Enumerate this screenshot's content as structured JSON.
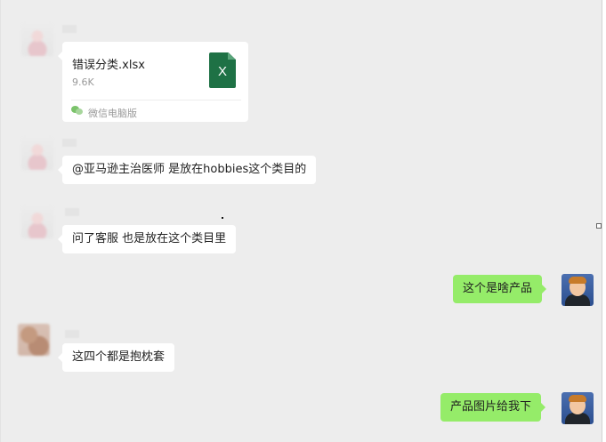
{
  "messages": [
    {
      "type": "file",
      "side": "left",
      "file": {
        "name": "错误分类.xlsx",
        "size": "9.6K",
        "icon": "excel-icon",
        "icon_letter": "X",
        "source": "微信电脑版"
      }
    },
    {
      "type": "text",
      "side": "left",
      "text": "@亚马逊主治医师 是放在hobbies这个类目的"
    },
    {
      "type": "text",
      "side": "left",
      "text": "问了客服 也是放在这个类目里"
    },
    {
      "type": "text",
      "side": "right",
      "text": "这个是啥产品"
    },
    {
      "type": "text",
      "side": "left",
      "text": "这四个都是抱枕套"
    },
    {
      "type": "text",
      "side": "right",
      "text": "产品图片给我下"
    }
  ],
  "colors": {
    "chat_background": "#ededed",
    "outgoing_bubble": "#95ec69",
    "incoming_bubble": "#ffffff",
    "excel_green": "#1e7145"
  }
}
